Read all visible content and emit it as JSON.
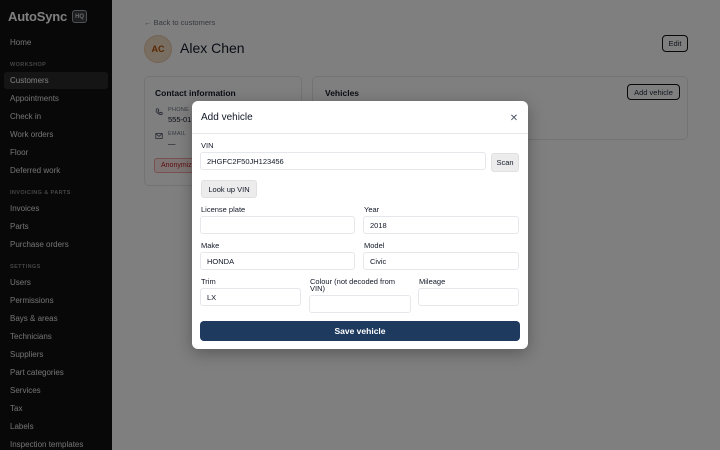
{
  "app": {
    "name": "AutoSync",
    "badge": "HQ"
  },
  "sidebar": {
    "items_top": [
      {
        "label": "Home"
      }
    ],
    "sections": [
      {
        "title": "WORKSHOP",
        "items": [
          "Customers",
          "Appointments",
          "Check in",
          "Work orders",
          "Floor",
          "Deferred work"
        ]
      },
      {
        "title": "INVOICING & PARTS",
        "items": [
          "Invoices",
          "Parts",
          "Purchase orders"
        ]
      },
      {
        "title": "SETTINGS",
        "items": [
          "Users",
          "Permissions",
          "Bays & areas",
          "Technicians",
          "Suppliers",
          "Part categories",
          "Services",
          "Tax",
          "Labels",
          "Inspection templates"
        ]
      }
    ],
    "active": "Customers"
  },
  "page": {
    "back_link": "← Back to customers",
    "avatar_initials": "AC",
    "customer_name": "Alex Chen",
    "edit_label": "Edit",
    "contact": {
      "title": "Contact information",
      "phone_label": "PHONE",
      "phone_value": "555-01",
      "email_label": "EMAIL",
      "email_value": "—",
      "badge": "Anonymiz"
    },
    "vehicles": {
      "title": "Vehicles",
      "add_label": "Add vehicle"
    }
  },
  "modal": {
    "title": "Add vehicle",
    "close_icon": "close-icon",
    "vin": {
      "label": "VIN",
      "value": "2HGFC2F50JH123456"
    },
    "scan_label": "Scan",
    "lookup_label": "Look up VIN",
    "license_plate": {
      "label": "License plate",
      "value": ""
    },
    "year": {
      "label": "Year",
      "value": "2018"
    },
    "make": {
      "label": "Make",
      "value": "HONDA"
    },
    "model": {
      "label": "Model",
      "value": "Civic"
    },
    "trim": {
      "label": "Trim",
      "value": "LX"
    },
    "colour": {
      "label": "Colour (not decoded from VIN)",
      "value": ""
    },
    "mileage": {
      "label": "Mileage",
      "value": ""
    },
    "save_label": "Save vehicle"
  },
  "colors": {
    "primary": "#1e3a5f",
    "sidebar_bg": "#111111",
    "overlay": "rgba(0,0,0,0.5)"
  }
}
